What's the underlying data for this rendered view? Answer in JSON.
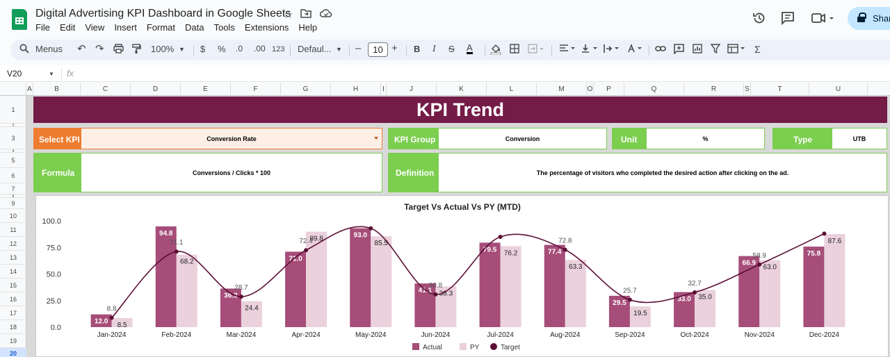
{
  "app": {
    "doc_title": "Digital Advertising KPI Dashboard in Google Sheets",
    "menu": [
      "File",
      "Edit",
      "View",
      "Insert",
      "Format",
      "Data",
      "Tools",
      "Extensions",
      "Help"
    ],
    "share_label": "Share",
    "icons": [
      "star-icon",
      "folder-move-icon",
      "cloud-status-icon",
      "history-icon",
      "comment-icon",
      "meet-icon",
      "lock-icon"
    ]
  },
  "toolbar": {
    "menus_label": "Menus",
    "zoom": "100%",
    "currency": "$",
    "percent": "%",
    "dec_decrease": ".0",
    "dec_increase": ".00",
    "number_format": "123",
    "font": "Defaul...",
    "font_size": "10",
    "minus": "–",
    "plus": "+",
    "bold": "B",
    "italic": "I",
    "sigma": "Σ"
  },
  "formula_bar": {
    "cell_ref": "V20",
    "fx": "fx",
    "formula": ""
  },
  "grid": {
    "columns": [
      "A",
      "B",
      "C",
      "D",
      "E",
      "F",
      "G",
      "H",
      "I",
      "J",
      "K",
      "L",
      "M",
      "O",
      "P",
      "Q",
      "R",
      "S",
      "T",
      "U"
    ],
    "rows": [
      "1",
      "2",
      "3",
      "4",
      "5",
      "6",
      "7",
      "8",
      "9",
      "10",
      "11",
      "12",
      "13",
      "14",
      "15",
      "16",
      "17",
      "18",
      "19",
      "20"
    ],
    "selected_row": "20"
  },
  "dashboard": {
    "banner": "KPI Trend",
    "select_kpi_label": "Select KPI",
    "select_kpi_value": "Conversion Rate",
    "kpi_group_label": "KPI Group",
    "kpi_group_value": "Conversion",
    "unit_label": "Unit",
    "unit_value": "%",
    "type_label": "Type",
    "type_value": "UTB",
    "formula_label": "Formula",
    "formula_value": "Conversions / Clicks * 100",
    "definition_label": "Definition",
    "definition_value": "The percentage of visitors who completed the desired action after clicking on the ad.",
    "colors": {
      "banner": "#741b47",
      "select": "#ed7d31",
      "green": "#7cce4f",
      "actual": "#a64d79",
      "py": "#ead1dc",
      "target": "#5b0f35"
    }
  },
  "chart_data": {
    "type": "bar",
    "title": "Target Vs Actual Vs PY (MTD)",
    "categories": [
      "Jan-2024",
      "Feb-2024",
      "Mar-2024",
      "Apr-2024",
      "May-2024",
      "Jun-2024",
      "Jul-2024",
      "Aug-2024",
      "Sep-2024",
      "Oct-2024",
      "Nov-2024",
      "Dec-2024"
    ],
    "ylim": [
      0,
      100
    ],
    "yticks": [
      "0.0",
      "25.0",
      "50.0",
      "75.0",
      "100.0"
    ],
    "legend_position": "bottom",
    "series": [
      {
        "name": "Actual",
        "type": "bar",
        "values": [
          12.0,
          94.8,
          36.3,
          71.0,
          93.0,
          41.1,
          79.5,
          77.4,
          29.5,
          33.0,
          66.9,
          75.8
        ],
        "labels": [
          "12.0",
          "94.8",
          "36.3",
          "71.0",
          "93.0",
          "41.1",
          "79.5",
          "77.4",
          "29.5",
          "33.0",
          "66.9",
          "75.8"
        ]
      },
      {
        "name": "PY",
        "type": "bar",
        "values": [
          8.5,
          68.2,
          24.4,
          89.8,
          85.5,
          38.3,
          76.2,
          63.3,
          19.5,
          35.0,
          63.0,
          87.6
        ],
        "labels": [
          "8.5",
          "68.2",
          "24.4",
          "89.8",
          "85.5",
          "38.3",
          "76.2",
          "63.3",
          "19.5",
          "35.0",
          "63.0",
          "87.6"
        ]
      },
      {
        "name": "Target",
        "type": "line",
        "values": [
          8.8,
          71.1,
          28.7,
          72.4,
          93.0,
          30.8,
          85.0,
          72.8,
          25.7,
          32.7,
          58.9,
          88.0
        ],
        "labels": [
          "8.8",
          "71.1",
          "28.7",
          "72.4",
          "",
          "30.8",
          "",
          "72.8",
          "25.7",
          "32.7",
          "58.9",
          ""
        ]
      }
    ]
  }
}
